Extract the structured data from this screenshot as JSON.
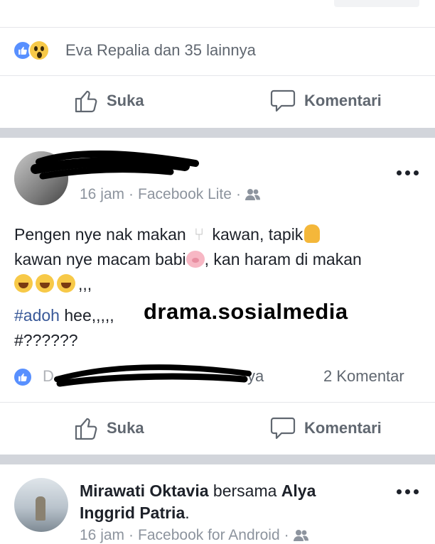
{
  "post1": {
    "reactions_text": "Eva Repalia dan 35 lainnya",
    "like_label": "Suka",
    "comment_label": "Komentari"
  },
  "post2": {
    "meta_time": "16 jam",
    "meta_source": "Facebook Lite",
    "body_line1_a": "Pengen nye nak makan",
    "body_line1_b": "kawan, tapik",
    "body_line2_a": "kawan nye macam babi",
    "body_line2_b": ", kan haram di makan",
    "body_line3_tail": ",,,",
    "hashtag1": "#adoh",
    "hashtag1_tail": " hee,,,,,",
    "hashtag2": "#??????",
    "watermark": "drama.sosialmedia",
    "reactions_visible_tail": "ya",
    "comments_count": "2 Komentar",
    "like_label": "Suka",
    "comment_label": "Komentari"
  },
  "post3": {
    "author": "Mirawati Oktavia",
    "with_word": "bersama",
    "tagged_line1": "Alya",
    "tagged_line2": "Inggrid Patria",
    "period": ".",
    "meta_time": "16 jam",
    "meta_source": "Facebook for Android"
  },
  "colors": {
    "facebook_blue": "#5890ff",
    "link_blue": "#385898",
    "secondary_text": "#606770",
    "separator": "#d2d5db"
  },
  "icons": [
    "like-reaction-icon",
    "wow-reaction-icon",
    "thumbs-up-icon",
    "comment-bubble-icon",
    "more-options-icon",
    "friends-audience-icon"
  ]
}
